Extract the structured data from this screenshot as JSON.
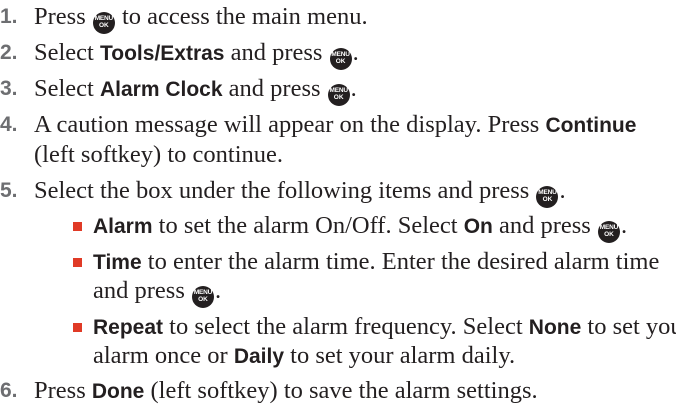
{
  "key_icon": {
    "top": "MENU",
    "bottom": "OK"
  },
  "steps": [
    {
      "num": "1.",
      "pre": "Press ",
      "post": " to access the main menu."
    },
    {
      "num": "2.",
      "pre": "Select ",
      "kw": "Tools/Extras",
      "mid": " and press ",
      "post": "."
    },
    {
      "num": "3.",
      "pre": "Select ",
      "kw": "Alarm Clock",
      "mid": " and press ",
      "post": "."
    },
    {
      "num": "4.",
      "line1_pre": "A caution message will appear on the display. Press ",
      "line1_kw": "Continue",
      "line2": "(left softkey) to continue."
    },
    {
      "num": "5.",
      "pre": "Select the box under the following items and press ",
      "post": "."
    },
    {
      "num": "6.",
      "pre": "Press ",
      "kw": "Done",
      "post": " (left softkey) to save the alarm settings."
    }
  ],
  "sub_items": [
    {
      "kw": "Alarm",
      "pre": " to set the alarm On/Off. Select ",
      "kw2": "On",
      "mid": " and press ",
      "post": "."
    },
    {
      "kw": "Time",
      "line1": " to enter the alarm time. Enter the desired alarm time",
      "line2_pre": "and press ",
      "line2_post": "."
    },
    {
      "kw": "Repeat",
      "line1_pre": " to select the alarm frequency. Select ",
      "line1_kw": "None",
      "line1_post": " to set your",
      "line2_pre": "alarm once or ",
      "line2_kw": "Daily",
      "line2_post": " to set your alarm daily."
    }
  ],
  "colors": {
    "text": "#231f20",
    "number": "#6d6e71",
    "bullet": "#e03a26",
    "key_bg": "#231f20"
  }
}
